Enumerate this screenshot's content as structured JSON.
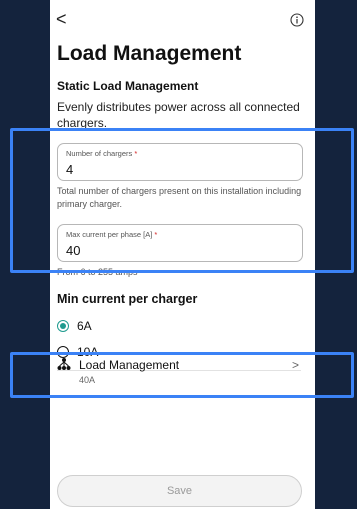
{
  "header": {
    "back_glyph": "<",
    "info_icon": "info-icon",
    "title": "Load Management"
  },
  "static": {
    "subtitle": "Static Load Management",
    "description": "Evenly distributes power across all connected chargers."
  },
  "fields": {
    "chargers": {
      "label": "Number of chargers",
      "required_mark": "*",
      "value": "4",
      "helper": "Total number of chargers present on this installation including primary charger."
    },
    "max_current": {
      "label": "Max current per phase [A]",
      "required_mark": "*",
      "value": "40",
      "helper": "From 6 to 255 amps"
    }
  },
  "min_current": {
    "title": "Min current per charger",
    "options": [
      {
        "label": "6A",
        "selected": true
      },
      {
        "label": "10A",
        "selected": false
      }
    ]
  },
  "load_management_item": {
    "icon": "network-icon",
    "label": "Load Management",
    "sub": "40A",
    "chevron": ">"
  },
  "save_label": "Save",
  "colors": {
    "background": "#14233d",
    "accent": "#1f9b8f",
    "highlight": "#3b82f6",
    "required": "#d32020"
  }
}
